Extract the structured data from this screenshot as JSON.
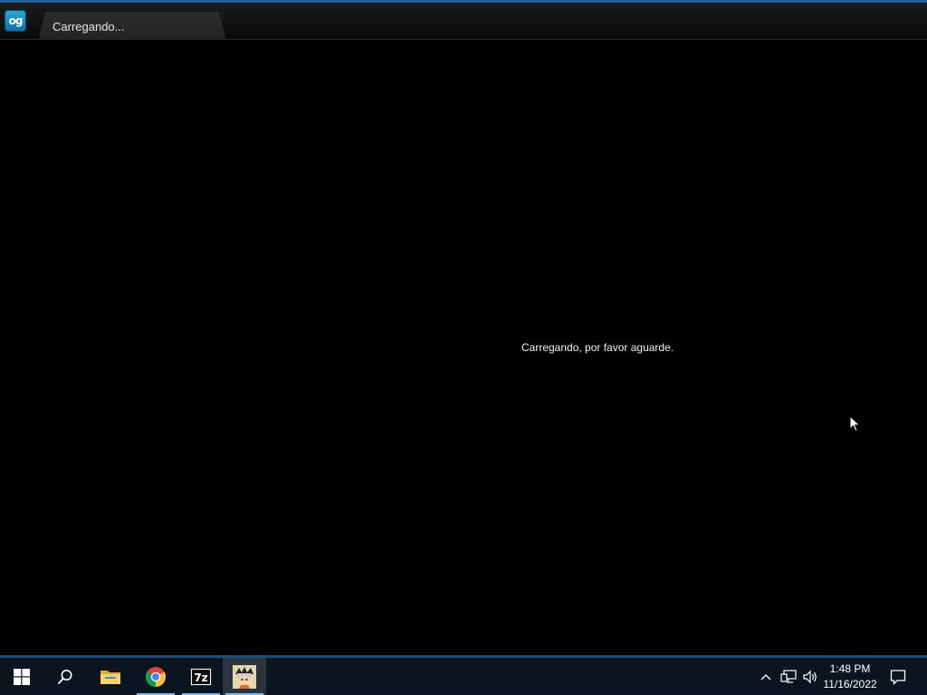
{
  "window": {
    "tab_title": "Carregando...",
    "app_icon_text": "og",
    "app_icon_name": "app-logo-icon"
  },
  "main": {
    "loading_message": "Carregando, por favor aguarde."
  },
  "taskbar": {
    "start": "windows-start-icon",
    "search": "search-icon",
    "apps": [
      {
        "name": "file-explorer-icon",
        "active": false
      },
      {
        "name": "chrome-icon",
        "active": false
      },
      {
        "name": "7zip-icon",
        "active": false,
        "label": "7z"
      },
      {
        "name": "game-app-icon",
        "active": true
      }
    ],
    "tray": {
      "chevron": "chevron-up-icon",
      "network": "network-icon",
      "volume": "volume-icon",
      "notifications": "notification-icon"
    },
    "clock": {
      "time": "1:48 PM",
      "date": "11/16/2022"
    }
  },
  "colors": {
    "accent": "#1e5f9e",
    "background": "#000000",
    "taskbar": "#0b1520"
  }
}
